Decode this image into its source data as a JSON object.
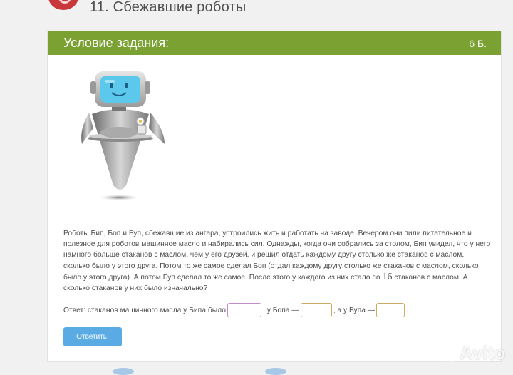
{
  "header": {
    "task_title": "11. Сбежавшие роботы"
  },
  "card": {
    "condition_title": "Условие задания:",
    "points": "6 Б."
  },
  "problem": {
    "part1": "Роботы Бип, Боп и Буп, сбежавшие из ангара, устроились жить и работать на заводе. Вечером они пили питательное и полезное для роботов машинное масло и набирались сил. Однажды, когда они собрались за столом, Бип увидел, что у него намного больше стаканов с маслом, чем у его друзей, и решил отдать каждому другу столько же стаканов с маслом, сколько было у этого друга. Потом то же самое сделал Боп (отдал каждому другу столько же стаканов с маслом, сколько было у этого друга). А потом Буп сделал то же самое. После этого у каждого из них стало по ",
    "number": "16",
    "part2": " стаканов с маслом. А сколько стаканов у них было изначально?"
  },
  "answer": {
    "prefix": "Ответ: стаканов машинного масла у Бипа было",
    "bop_label": ", у Бопа —",
    "bup_label": ", а у Бупа —",
    "suffix": ".",
    "bip_value": "",
    "bop_value": "",
    "bup_value": ""
  },
  "submit": {
    "label": "Ответить!"
  },
  "watermark": {
    "text": "Avito"
  },
  "colors": {
    "header_green": "#7aa131",
    "button_blue": "#5aabe3",
    "badge_red": "#c9373a",
    "robot_screen": "#5cc8ec"
  },
  "icons": [
    "robot-illustration",
    "avito-logo-icon"
  ]
}
